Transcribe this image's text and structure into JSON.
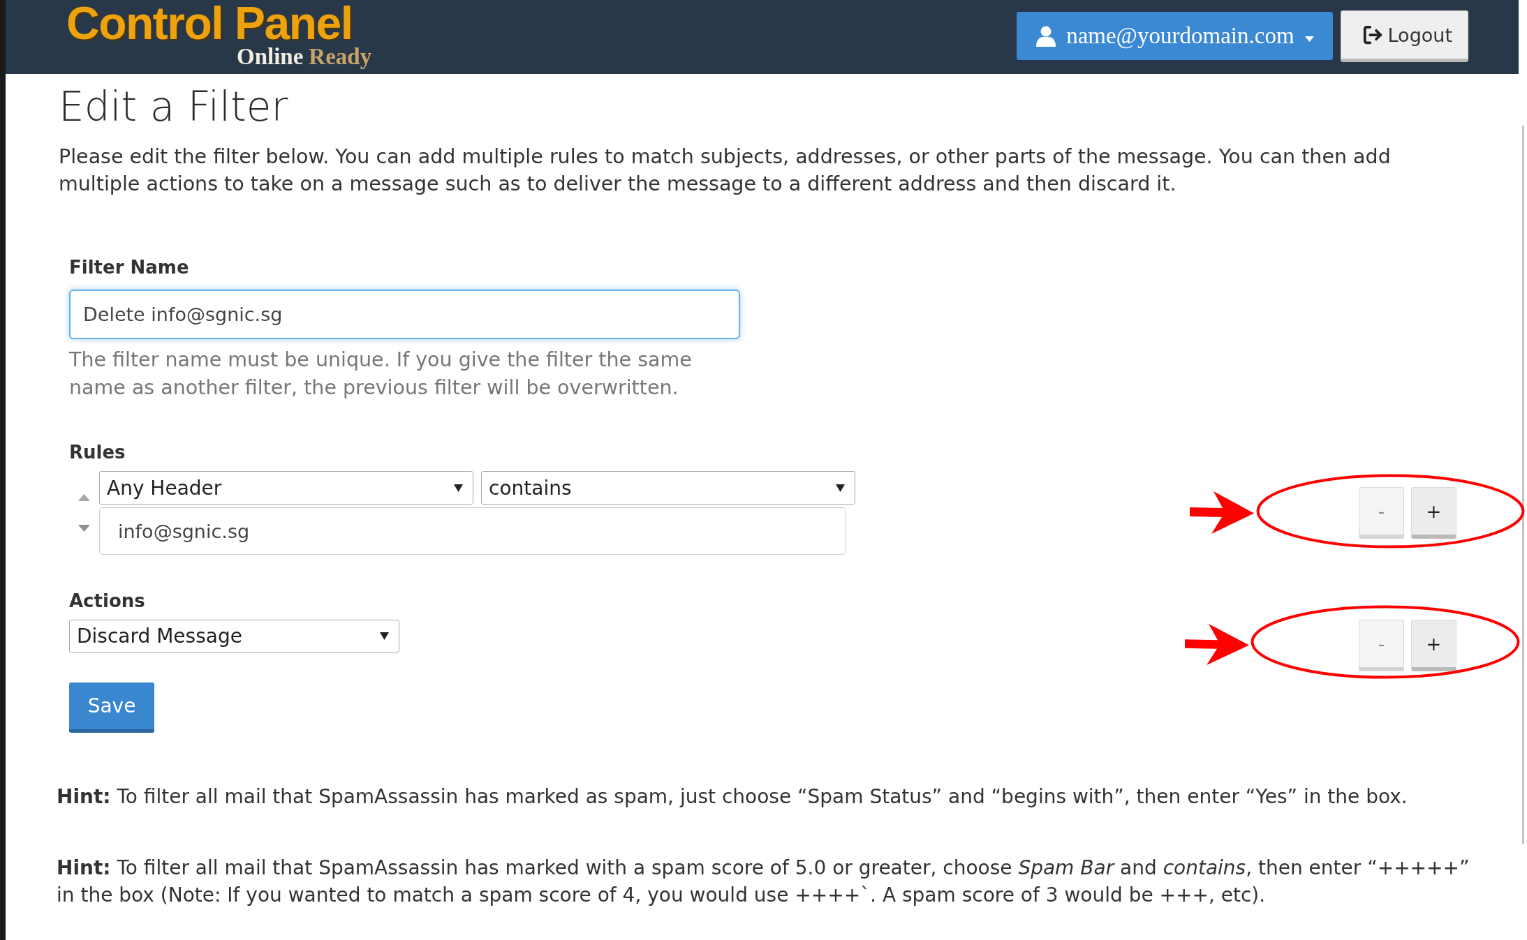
{
  "header": {
    "logo": {
      "title": "Control Panel",
      "tagline_first": "Online",
      "tagline_second": "Ready"
    },
    "user_menu": {
      "label": "name@yourdomain.com"
    },
    "logout_button": {
      "label": "Logout"
    }
  },
  "page": {
    "title": "Edit a Filter",
    "intro": "Please edit the filter below. You can add multiple rules to match subjects, addresses, or other parts of the message. You can then add multiple actions to take on a message such as to deliver the message to a different address and then discard it."
  },
  "filter_name": {
    "label": "Filter Name",
    "value": "Delete info@sgnic.sg",
    "focused": true,
    "help": "The filter name must be unique. If you give the filter the same name as another filter, the previous filter will be overwritten."
  },
  "rules": {
    "label": "Rules",
    "items": [
      {
        "field": "Any Header",
        "condition": "contains",
        "value": "info@sgnic.sg",
        "buttons": [
          {
            "label": "-",
            "disabled": true
          },
          {
            "label": "+",
            "disabled": false
          }
        ]
      }
    ]
  },
  "actions": {
    "label": "Actions",
    "items": [
      {
        "action": "Discard Message",
        "buttons": [
          {
            "label": "-",
            "disabled": true
          },
          {
            "label": "+",
            "disabled": false
          }
        ]
      }
    ]
  },
  "save_button": {
    "label": "Save"
  },
  "hints": [
    "**Hint:** To filter all mail that SpamAssassin has marked as spam, just choose “Spam Status” and “begins with”, then enter “Yes” in the box.",
    "**Hint:** To filter all mail that SpamAssassin has marked with a spam score of 5.0 or greater, choose *Spam Bar* and *contains*, then enter “+++++” in the box (Note: If you wanted to match a spam score of 4, you would use ++++`. A spam score of 3 would be +++, etc)."
  ]
}
